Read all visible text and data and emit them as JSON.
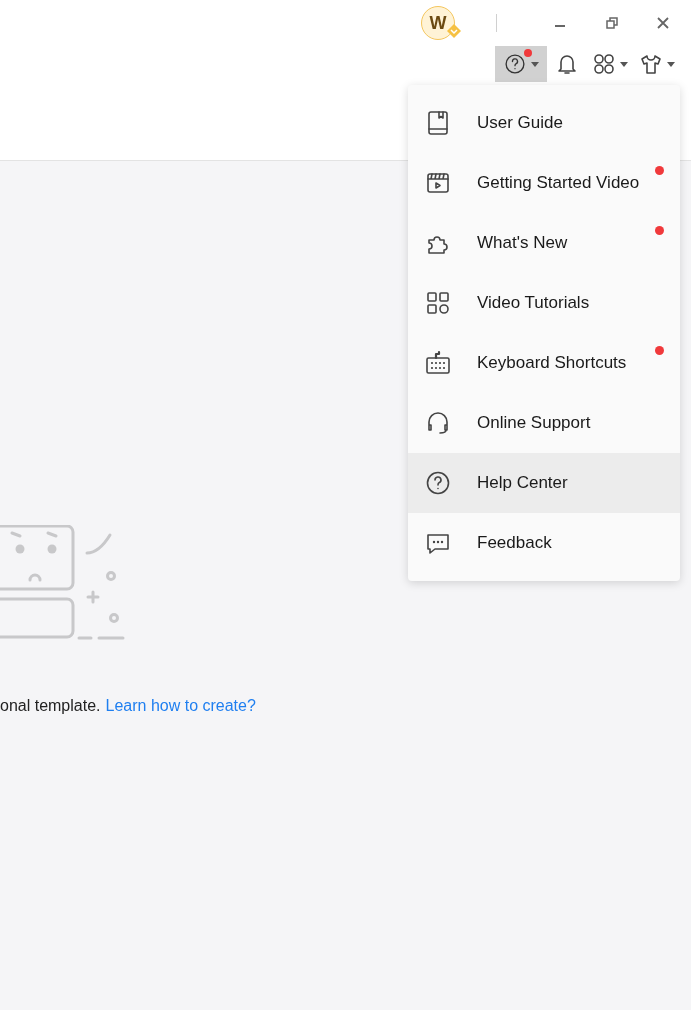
{
  "title_bar": {
    "avatar_letter": "W"
  },
  "toolbar": {
    "help_badge": true,
    "help_active": true
  },
  "help_menu": {
    "items": [
      {
        "label": "User Guide",
        "badge": false,
        "selected": false
      },
      {
        "label": "Getting Started Video",
        "badge": true,
        "selected": false
      },
      {
        "label": "What's New",
        "badge": true,
        "selected": false
      },
      {
        "label": "Video Tutorials",
        "badge": false,
        "selected": false
      },
      {
        "label": "Keyboard Shortcuts",
        "badge": true,
        "selected": false
      },
      {
        "label": "Online Support",
        "badge": false,
        "selected": false
      },
      {
        "label": "Help Center",
        "badge": false,
        "selected": true
      },
      {
        "label": "Feedback",
        "badge": false,
        "selected": false
      }
    ]
  },
  "empty_state": {
    "message": "onal template.",
    "link": "Learn how to create?"
  }
}
